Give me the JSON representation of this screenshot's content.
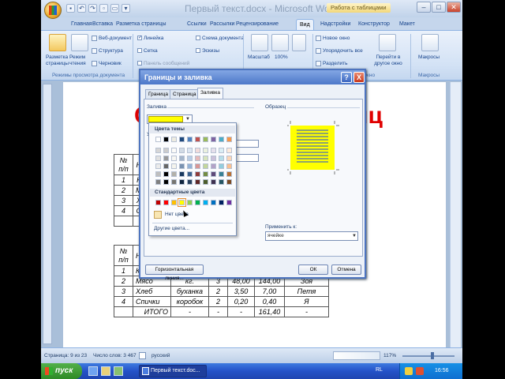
{
  "window": {
    "title": "Первый текст.docx - Microsoft Word",
    "context_tab_group": "Работа с таблицами"
  },
  "ribbon_tabs": [
    "Главная",
    "Вставка",
    "Разметка страницы",
    "Ссылки",
    "Рассылки",
    "Рецензирование",
    "Вид",
    "Надстройки",
    "Конструктор",
    "Макет"
  ],
  "ribbon": {
    "views": {
      "print_layout": "Разметка страницы",
      "reading": "Режим чтения",
      "web": "Веб-документ",
      "outline": "Структура",
      "draft": "Черновик",
      "group_label": "Режимы просмотра документа"
    },
    "show": {
      "ruler": "Линейка",
      "grid": "Сетка",
      "message_bar": "Панель сообщений",
      "doc_map": "Схема документа",
      "thumbnails": "Эскизы"
    },
    "zoom": {
      "zoom": "Масштаб",
      "hundred": "100%"
    },
    "window": {
      "new_window": "Новое окно",
      "arrange_all": "Упорядочить все",
      "split": "Разделить",
      "switch": "Перейти в другое окно",
      "group_label": "Окно"
    },
    "macros": {
      "label": "Макросы",
      "group_label": "Макросы"
    }
  },
  "document": {
    "heading_left": "С",
    "heading_right": "иц",
    "table1": {
      "headers": [
        "№ п/п",
        "Н"
      ],
      "rows": [
        [
          "1",
          "К"
        ],
        [
          "2",
          "М"
        ],
        [
          "3",
          "Х"
        ],
        [
          "4",
          "С"
        ],
        [
          "",
          ""
        ]
      ]
    },
    "table2": {
      "headers": [
        "№ п/п",
        "Н"
      ],
      "rows": [
        [
          "1",
          "К",
          "",
          "",
          "",
          "",
          ""
        ],
        [
          "2",
          "Мясо",
          "кг.",
          "3",
          "48,00",
          "144,00",
          "Зоя"
        ],
        [
          "3",
          "Хлеб",
          "буханка",
          "2",
          "3,50",
          "7,00",
          "Петя"
        ],
        [
          "4",
          "Спички",
          "коробок",
          "2",
          "0,20",
          "0,40",
          "Я"
        ],
        [
          "",
          "ИТОГО",
          "-",
          "-",
          "-",
          "161,40",
          "-"
        ]
      ]
    }
  },
  "status_bar": {
    "page": "Страница: 9 из 23",
    "words": "Число слов: 3 467",
    "language": "русский",
    "zoom": "117%"
  },
  "taskbar": {
    "start": "пуск",
    "task_item": "Первый текст.doc...",
    "lang": "RL",
    "clock": "16:56"
  },
  "dialog": {
    "title": "Границы и заливка",
    "help": "?",
    "close": "X",
    "tabs": [
      "Граница",
      "Страница",
      "Заливка"
    ],
    "fill_label": "Заливка",
    "pattern_label": "У",
    "preview_label": "Образец",
    "apply_to_label": "Применить к:",
    "apply_to_value": "ячейке",
    "horizontal_line_button": "Горизонтальная линия...",
    "ok": "ОК",
    "cancel": "Отмена",
    "fill_color": "#ffff00"
  },
  "palette": {
    "theme_header": "Цвета темы",
    "standard_header": "Стандартные цвета",
    "no_color": "Нет цвета",
    "more_colors": "Другие цвета...",
    "theme_row": [
      "#ffffff",
      "#000000",
      "#eeece1",
      "#1f497d",
      "#4f81bd",
      "#c0504d",
      "#9bbb59",
      "#8064a2",
      "#4bacc6",
      "#f79646"
    ],
    "standard_row": [
      "#c00000",
      "#ff0000",
      "#ffc000",
      "#ffff00",
      "#92d050",
      "#00b050",
      "#00b0f0",
      "#0070c0",
      "#002060",
      "#7030a0"
    ],
    "selected_standard_index": 3
  }
}
